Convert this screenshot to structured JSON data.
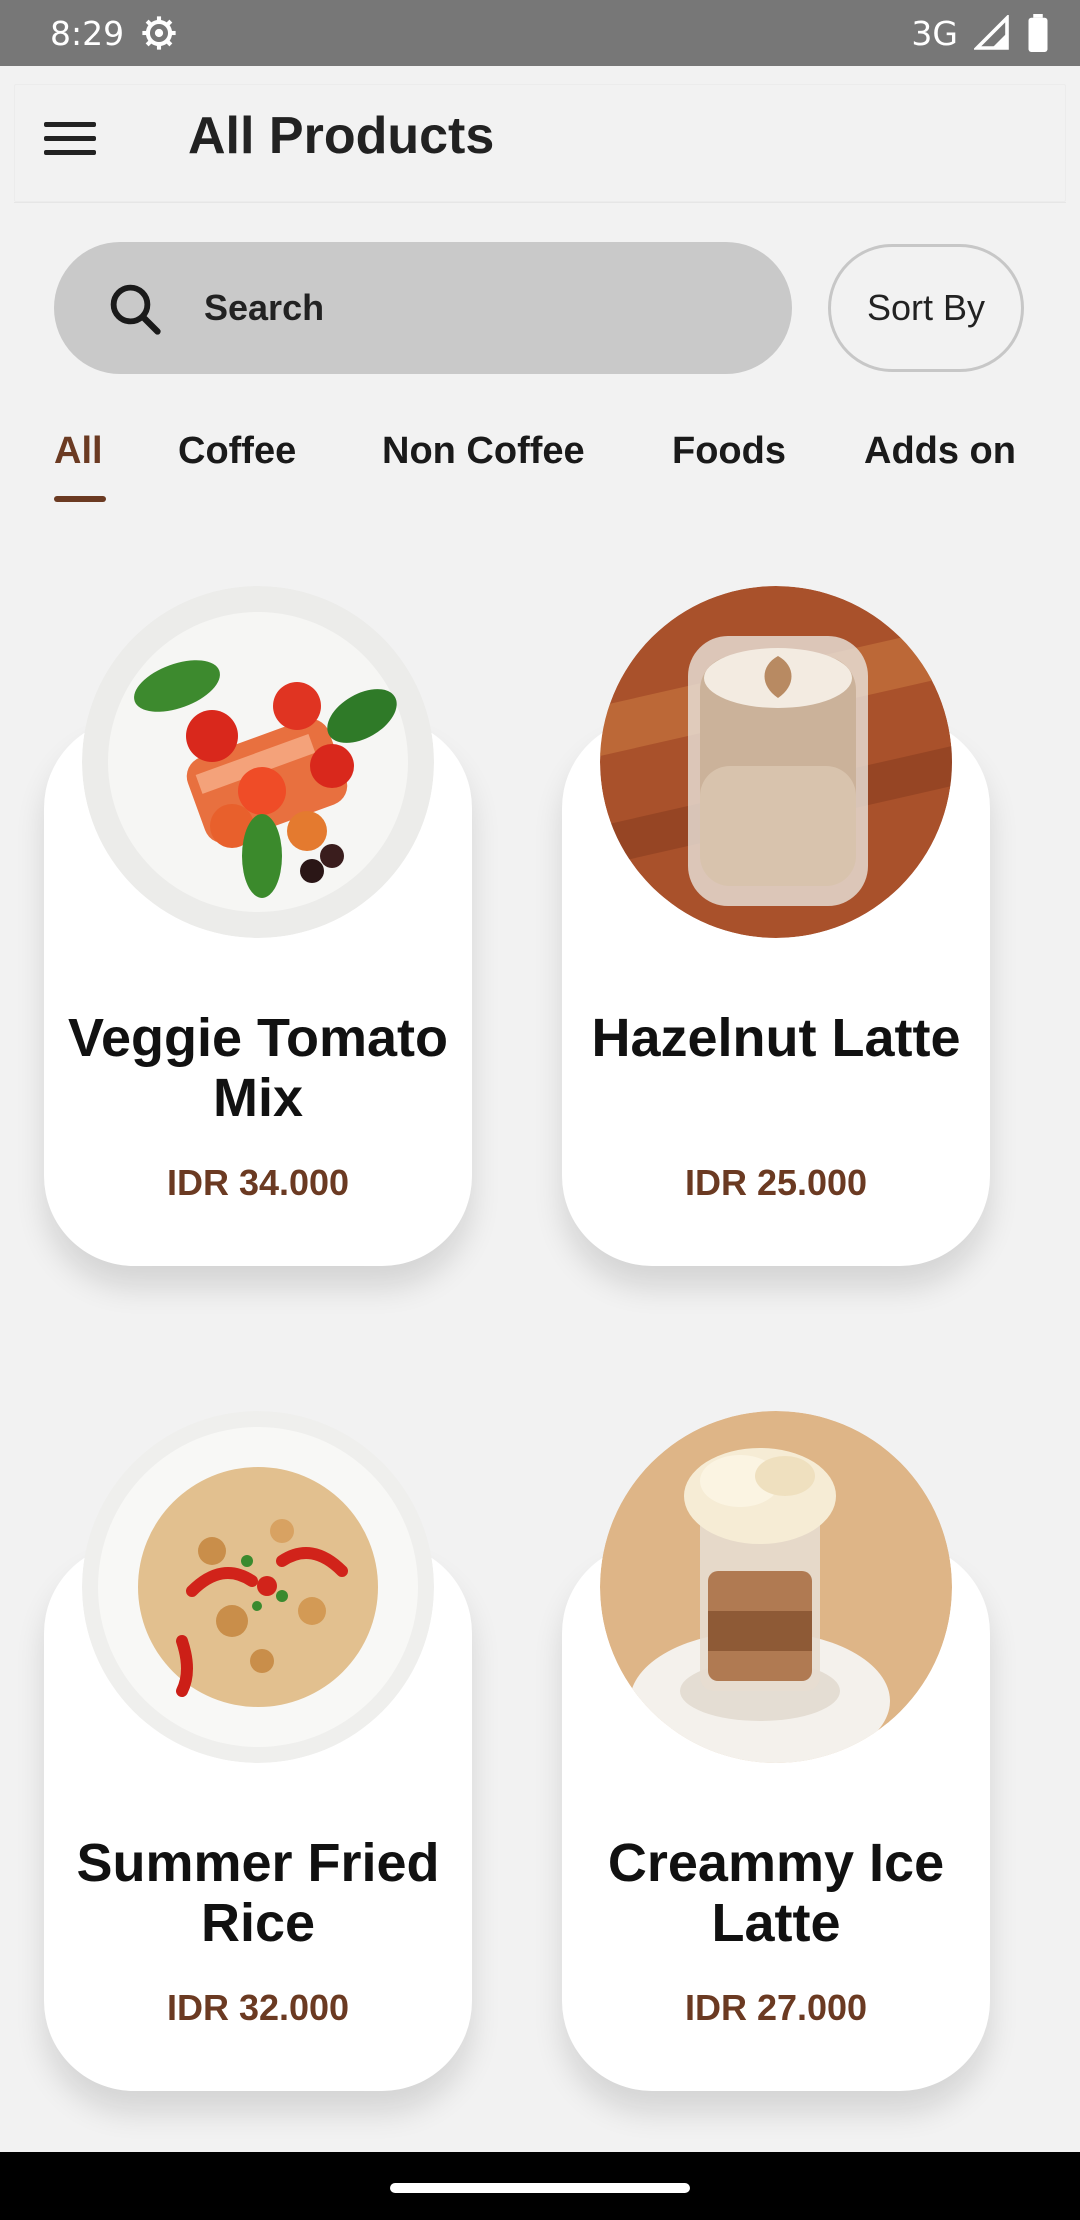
{
  "status_bar": {
    "time": "8:29",
    "network": "3G"
  },
  "app_bar": {
    "title": "All Products"
  },
  "search": {
    "placeholder": "Search",
    "value": ""
  },
  "sort": {
    "label": "Sort By"
  },
  "tabs": [
    {
      "label": "All",
      "active": true
    },
    {
      "label": "Coffee",
      "active": false
    },
    {
      "label": "Non Coffee",
      "active": false
    },
    {
      "label": "Foods",
      "active": false
    },
    {
      "label": "Adds on",
      "active": false
    }
  ],
  "products": [
    {
      "name": "Veggie Tomato Mix",
      "price": "IDR 34.000",
      "image": "salmon-salad-image"
    },
    {
      "name": "Hazelnut Latte",
      "price": "IDR 25.000",
      "image": "latte-image"
    },
    {
      "name": "Summer Fried Rice",
      "price": "IDR 32.000",
      "image": "fried-rice-image"
    },
    {
      "name": "Creammy Ice Latte",
      "price": "IDR 27.000",
      "image": "ice-latte-image"
    }
  ],
  "colors": {
    "accent": "#6b3a22",
    "search_bg": "#c9c9c9",
    "background": "#f2f2f2"
  }
}
